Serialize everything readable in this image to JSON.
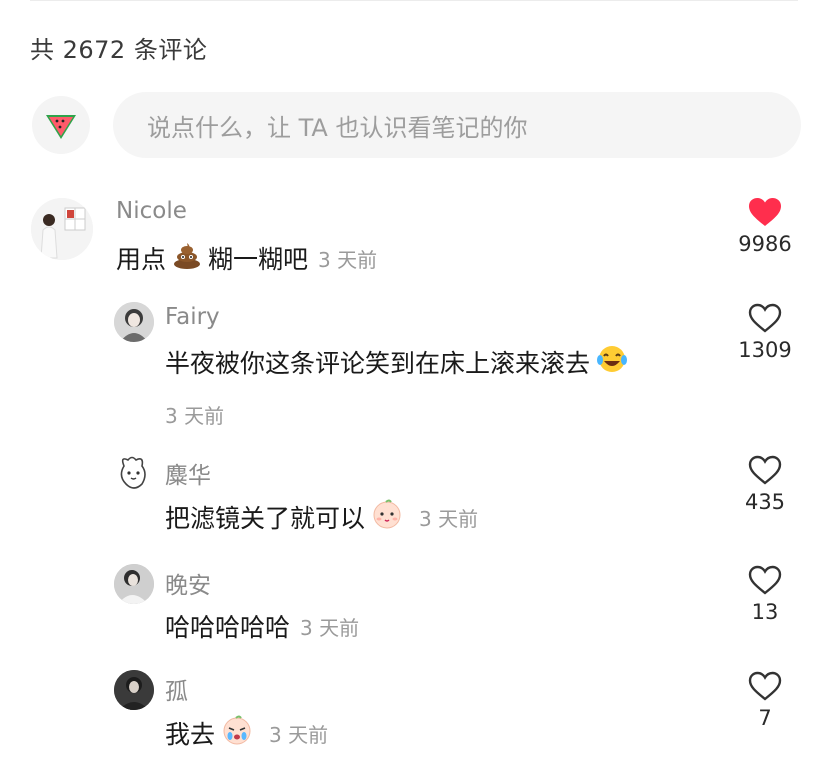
{
  "header": {
    "count_text": "共 2672 条评论"
  },
  "composer": {
    "placeholder": "说点什么，让 TA 也认识看笔记的你",
    "avatar_icon": "watermelon-icon"
  },
  "comments": [
    {
      "user": "Nicole",
      "text": "用点",
      "emoji": "poop-emoji",
      "text2": "糊一糊吧",
      "time": "3 天前",
      "likes": "9986",
      "liked": true
    },
    {
      "user": "Fairy",
      "text": "半夜被你这条评论笑到在床上滚来滚去",
      "emoji": "laughing-tears-emoji",
      "time": "3 天前",
      "likes": "1309",
      "liked": false
    },
    {
      "user": "麋华",
      "text": "把滤镜关了就可以",
      "emoji": "baby-face-emoji",
      "time": "3 天前",
      "likes": "435",
      "liked": false
    },
    {
      "user": "晚安",
      "text": "哈哈哈哈哈",
      "time": "3 天前",
      "likes": "13",
      "liked": false
    },
    {
      "user": "孤",
      "text": "我去",
      "emoji": "crying-face-emoji",
      "time": "3 天前",
      "likes": "7",
      "liked": false
    }
  ],
  "colors": {
    "like_active": "#ff2e4d",
    "heart_outline": "#333333"
  }
}
